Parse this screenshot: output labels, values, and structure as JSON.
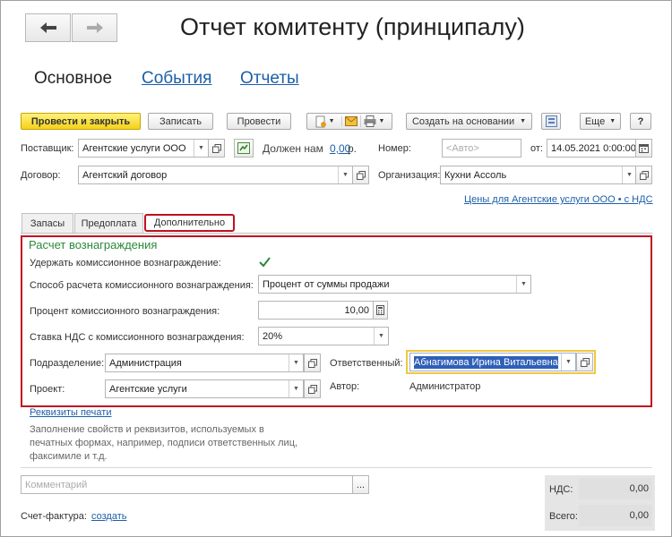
{
  "header": {
    "title": "Отчет комитенту (принципалу)",
    "back_icon": "arrow-left-icon",
    "forward_icon": "arrow-right-icon"
  },
  "main_tabs": [
    {
      "label": "Основное",
      "active": true
    },
    {
      "label": "События",
      "active": false
    },
    {
      "label": "Отчеты",
      "active": false
    }
  ],
  "toolbar": {
    "post_close": "Провести и закрыть",
    "save": "Записать",
    "post": "Провести",
    "create_basis": "Создать на основании",
    "more": "Еще",
    "help": "?"
  },
  "form": {
    "supplier_label": "Поставщик:",
    "supplier_value": "Агентские услуги ООО",
    "owes_text": "Должен нам",
    "owes_amount": "0,00",
    "owes_currency": "р.",
    "number_label": "Номер:",
    "number_placeholder": "<Авто>",
    "date_from_label": "от:",
    "date_value": "14.05.2021  0:00:00",
    "contract_label": "Договор:",
    "contract_value": "Агентский договор",
    "org_label": "Организация:",
    "org_value": "Кухни Ассоль",
    "prices_link": "Цены для Агентские услуги ООО • с НДС"
  },
  "sub_tabs": [
    {
      "label": "Запасы",
      "active": false
    },
    {
      "label": "Предоплата",
      "active": false
    },
    {
      "label": "Дополнительно",
      "active": true
    }
  ],
  "reward": {
    "title": "Расчет вознаграждения",
    "withhold_label": "Удержать комиссионное вознаграждение:",
    "withhold_checked": true,
    "method_label": "Способ расчета комиссионного вознаграждения:",
    "method_value": "Процент от суммы продажи",
    "percent_label": "Процент комиссионного вознаграждения:",
    "percent_value": "10,00",
    "vat_label": "Ставка НДС с комиссионного вознаграждения:",
    "vat_value": "20%",
    "division_label": "Подразделение:",
    "division_value": "Администрация",
    "responsible_label": "Ответственный:",
    "responsible_value": "Абнагимова Ирина Витальевна",
    "project_label": "Проект:",
    "project_value": "Агентские услуги",
    "author_label": "Автор:",
    "author_value": "Администратор"
  },
  "print": {
    "link": "Реквизиты печати",
    "description_line1": "Заполнение свойств и реквизитов, используемых в",
    "description_line2": "печатных формах, например, подписи ответственных лиц,",
    "description_line3": "факсимиле и т.д."
  },
  "footer": {
    "comment_placeholder": "Комментарий",
    "comment_btn": "...",
    "invoice_label": "Счет-фактура:",
    "invoice_link": "создать",
    "vat_label": "НДС:",
    "vat_value": "0,00",
    "total_label": "Всего:",
    "total_value": "0,00"
  }
}
